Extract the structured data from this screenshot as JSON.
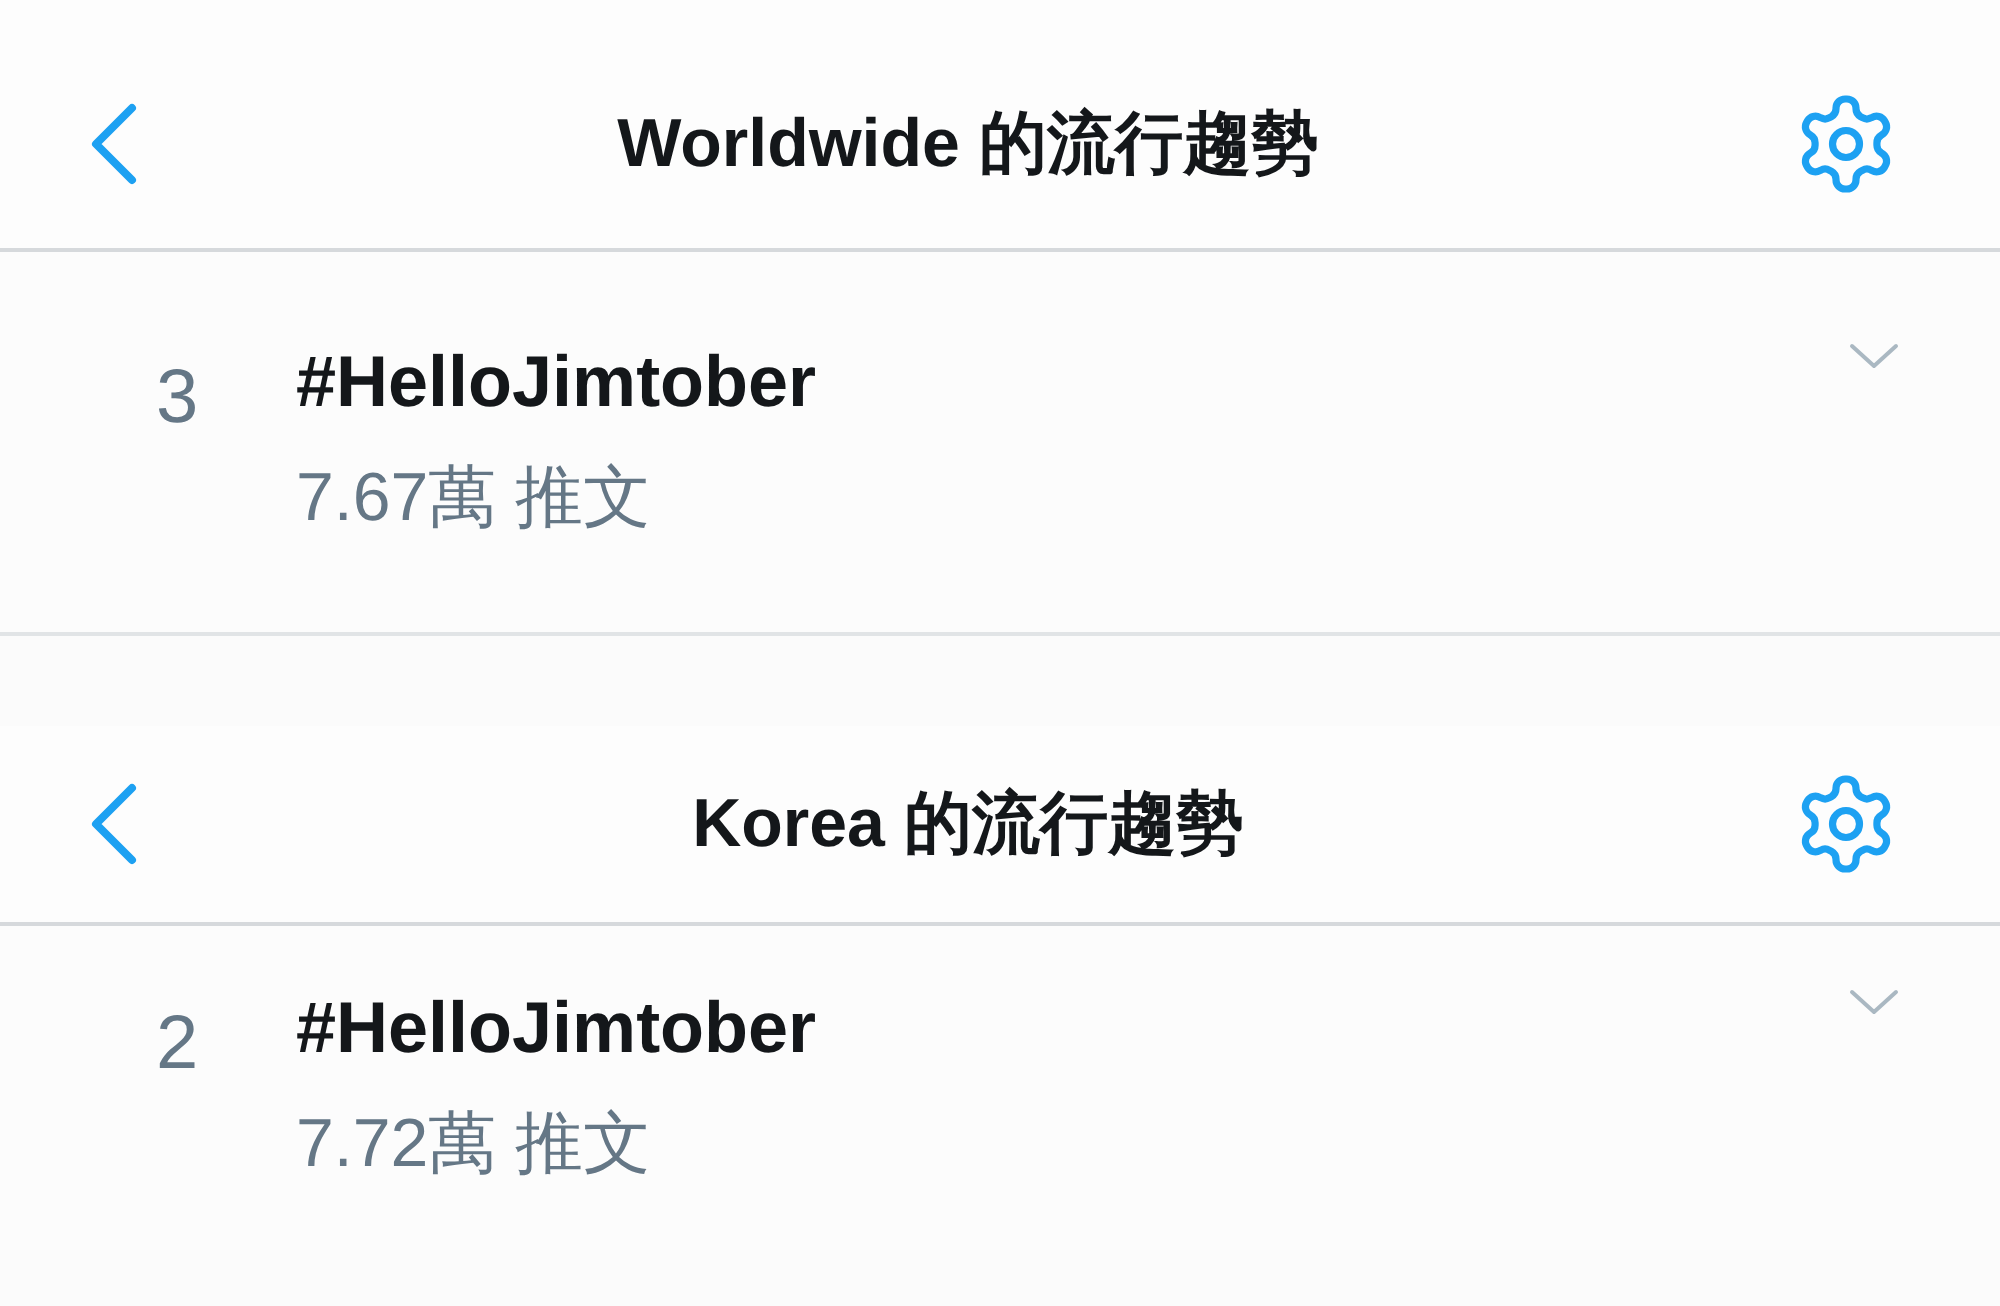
{
  "sections": [
    {
      "header": {
        "title": "Worldwide 的流行趨勢"
      },
      "trends": [
        {
          "rank": "3",
          "hashtag": "#HelloJimtober",
          "count": "7.67萬 推文"
        }
      ]
    },
    {
      "header": {
        "title": "Korea 的流行趨勢"
      },
      "trends": [
        {
          "rank": "2",
          "hashtag": "#HelloJimtober",
          "count": "7.72萬 推文"
        }
      ]
    }
  ]
}
